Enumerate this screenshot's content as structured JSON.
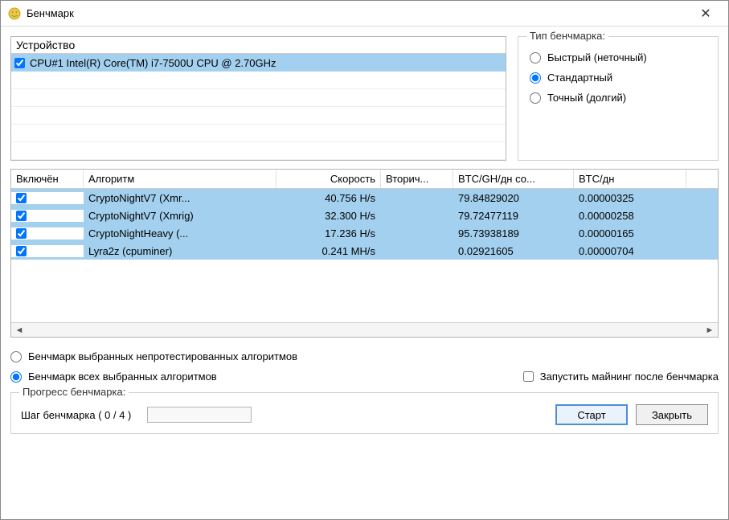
{
  "window": {
    "title": "Бенчмарк"
  },
  "device": {
    "header": "Устройство",
    "rows": [
      {
        "checked": true,
        "label": "CPU#1 Intel(R) Core(TM) i7-7500U CPU @ 2.70GHz"
      }
    ]
  },
  "bench_type": {
    "legend": "Тип бенчмарка:",
    "options": {
      "fast": "Быстрый (неточный)",
      "standard": "Стандартный",
      "precise": "Точный (долгий)"
    },
    "selected": "standard"
  },
  "algo": {
    "headers": {
      "enabled": "Включён",
      "algorithm": "Алгоритм",
      "speed": "Скорость",
      "secondary": "Вторич...",
      "btc_gh": "BTC/GH/дн со...",
      "btc_dn": "BTC/дн"
    },
    "rows": [
      {
        "checked": true,
        "algorithm": "CryptoNightV7 (Xmr...",
        "speed": "40.756 H/s",
        "secondary": "",
        "btc_gh": "79.84829020",
        "btc_dn": "0.00000325"
      },
      {
        "checked": true,
        "algorithm": "CryptoNightV7 (Xmrig)",
        "speed": "32.300 H/s",
        "secondary": "",
        "btc_gh": "79.72477119",
        "btc_dn": "0.00000258"
      },
      {
        "checked": true,
        "algorithm": "CryptoNightHeavy (...",
        "speed": "17.236 H/s",
        "secondary": "",
        "btc_gh": "95.73938189",
        "btc_dn": "0.00000165"
      },
      {
        "checked": true,
        "algorithm": "Lyra2z (cpuminer)",
        "speed": "0.241 MH/s",
        "secondary": "",
        "btc_gh": "0.02921605",
        "btc_dn": "0.00000704"
      }
    ]
  },
  "bench_scope": {
    "untested": "Бенчмарк выбранных непротестированных алгоритмов",
    "all": "Бенчмарк всех выбранных алгоритмов",
    "selected": "all"
  },
  "start_mining": {
    "label": "Запустить майнинг после бенчмарка",
    "checked": false
  },
  "progress": {
    "legend": "Прогресс бенчмарка:",
    "step_label": "Шаг бенчмарка ( 0 / 4 )"
  },
  "buttons": {
    "start": "Старт",
    "close": "Закрыть"
  }
}
